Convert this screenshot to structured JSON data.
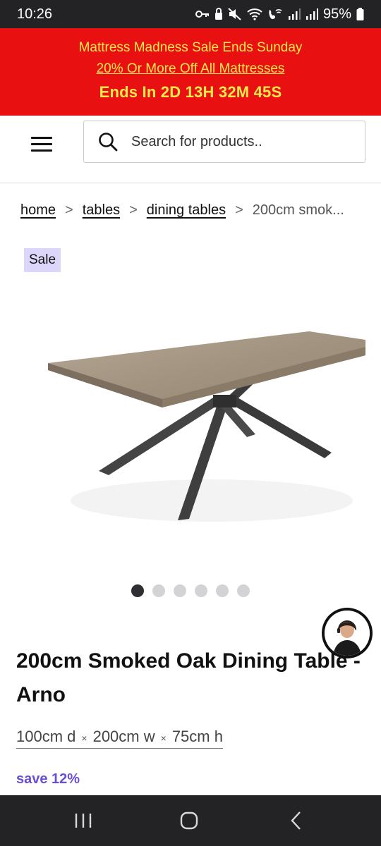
{
  "status_bar": {
    "time": "10:26",
    "battery": "95%",
    "icons": [
      "key-icon",
      "lock-icon",
      "mute-icon",
      "wifi-icon",
      "wifi-call-icon",
      "signal-icon",
      "signal-icon",
      "battery-icon"
    ]
  },
  "promo": {
    "line1": "Mattress Madness Sale Ends Sunday",
    "line2": "20% Or More Off All Mattresses",
    "countdown": "Ends In 2D 13H 32M 45S",
    "background_color": "#e81010",
    "text_color": "#ffe94d"
  },
  "header": {
    "menu_icon": "hamburger-menu-icon",
    "search_icon": "search-icon",
    "search_placeholder": "Search for products.."
  },
  "breadcrumb": {
    "items": [
      "home",
      "tables",
      "dining tables"
    ],
    "separator": ">",
    "current": "200cm smok..."
  },
  "product": {
    "badge": "Sale",
    "title": "200cm Smoked Oak Dining Table - Arno",
    "dimensions": {
      "depth": "100cm d",
      "width": "200cm w",
      "height": "75cm h",
      "separator": "×"
    },
    "save": "save 12%",
    "gallery": {
      "total_images": 6,
      "active_index": 0
    }
  },
  "chat": {
    "icon": "chat-agent-avatar-icon"
  },
  "nav_bar": {
    "icons": [
      "recent-apps-icon",
      "home-icon",
      "back-icon"
    ]
  },
  "colors": {
    "accent": "#6b4fd6",
    "badge_bg": "#dcd6fb",
    "system_bar": "#232325"
  }
}
